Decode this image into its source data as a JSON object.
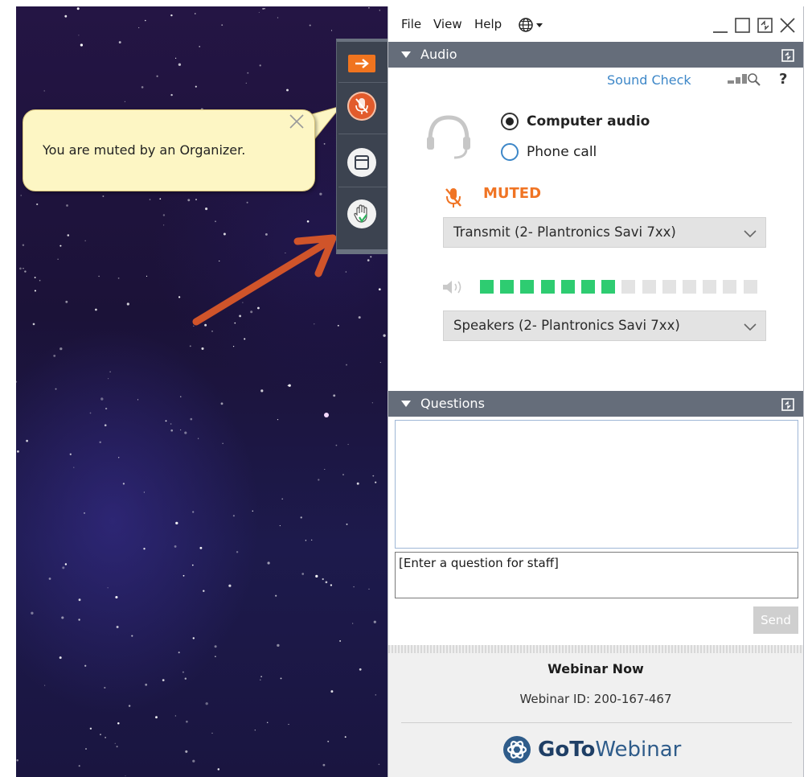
{
  "menu": {
    "file": "File",
    "view": "View",
    "help": "Help"
  },
  "tooltip": {
    "text": "You are muted by an Organizer."
  },
  "audio": {
    "header": "Audio",
    "sound_check": "Sound Check",
    "help": "?",
    "options": {
      "computer_audio": "Computer audio",
      "phone_call": "Phone call"
    },
    "selected_option": "Computer audio",
    "mute_status": "MUTED",
    "transmit_device": "Transmit (2- Plantronics Savi 7xx)",
    "speakers_device": "Speakers (2- Plantronics Savi 7xx)",
    "volume_level": {
      "active": 7,
      "total": 14
    }
  },
  "questions": {
    "header": "Questions",
    "input_placeholder": "[Enter a question for staff]",
    "send": "Send"
  },
  "footer": {
    "webinar_title": "Webinar Now",
    "webinar_id": "Webinar ID: 200-167-467",
    "brand_bold": "GoTo",
    "brand_light": "Webinar"
  },
  "colors": {
    "accent_orange": "#f07424",
    "header_gray": "#656d7a",
    "link_blue": "#3d87c8",
    "meter_green": "#2ecc71",
    "meter_empty": "#e3e3e3"
  },
  "icons": {
    "expand": "arrow-right-icon",
    "mute": "mic-muted-icon",
    "screen": "window-icon",
    "hand": "raise-hand-icon",
    "globe": "globe-icon",
    "headset": "headset-icon",
    "speaker": "speaker-icon",
    "brand": "gotowebinar-logo-icon"
  }
}
